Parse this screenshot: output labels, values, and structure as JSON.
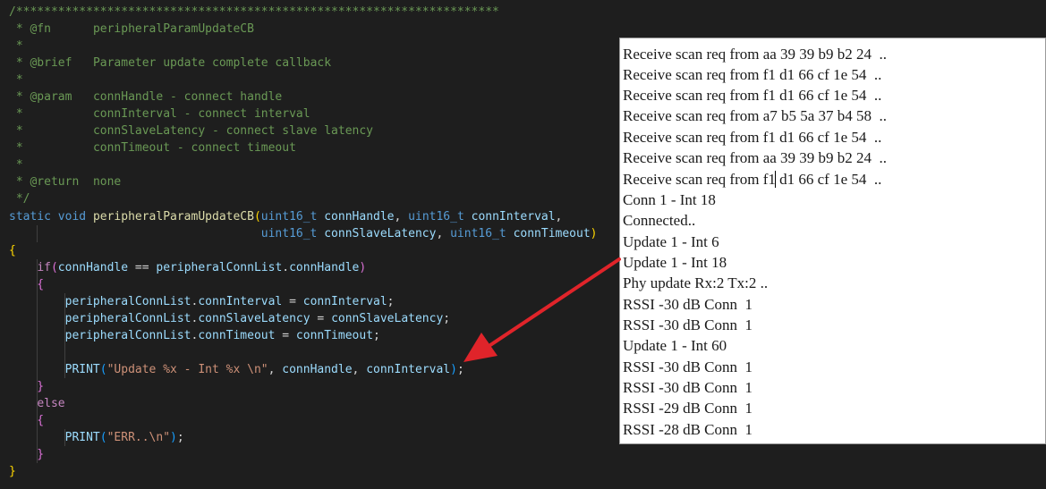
{
  "editor": {
    "lines": [
      "/*********************************************************************",
      " * @fn      peripheralParamUpdateCB",
      " *",
      " * @brief   Parameter update complete callback",
      " *",
      " * @param   connHandle - connect handle",
      " *          connInterval - connect interval",
      " *          connSlaveLatency - connect slave latency",
      " *          connTimeout - connect timeout",
      " *",
      " * @return  none",
      " */",
      "static void peripheralParamUpdateCB(uint16_t connHandle, uint16_t connInterval,",
      "                                    uint16_t connSlaveLatency, uint16_t connTimeout)",
      "{",
      "    if(connHandle == peripheralConnList.connHandle)",
      "    {",
      "        peripheralConnList.connInterval = connInterval;",
      "        peripheralConnList.connSlaveLatency = connSlaveLatency;",
      "        peripheralConnList.connTimeout = connTimeout;",
      "",
      "        PRINT(\"Update %x - Int %x \\n\", connHandle, connInterval);",
      "    }",
      "    else",
      "    {",
      "        PRINT(\"ERR..\\n\");",
      "    }",
      "}"
    ],
    "tokens": {
      "comment_border": "/*********************************************************************",
      "comment_star": " *",
      "comment_end": " */",
      "tag_fn": "@fn",
      "fn_name": "peripheralParamUpdateCB",
      "tag_brief": "@brief",
      "brief_text": "Parameter update complete callback",
      "tag_param": "@param",
      "param1": "connHandle - connect handle",
      "param2": "connInterval - connect interval",
      "param3": "connSlaveLatency - connect slave latency",
      "param4": "connTimeout - connect timeout",
      "tag_return": "@return",
      "return_text": "none",
      "kw_static": "static",
      "kw_void": "void",
      "type_u16": "uint16_t",
      "p_connHandle": "connHandle",
      "p_connInterval": "connInterval",
      "p_connSlaveLatency": "connSlaveLatency",
      "p_connTimeout": "connTimeout",
      "kw_if": "if",
      "kw_else": "else",
      "print": "PRINT",
      "list": "peripheralConnList",
      "f_connHandle": "connHandle",
      "f_connInterval": "connInterval",
      "f_connSlaveLatency": "connSlaveLatency",
      "f_connTimeout": "connTimeout",
      "str_update": "\"Update %x - Int %x \\n\"",
      "str_err": "\"ERR..\\n\""
    }
  },
  "terminal": {
    "lines": [
      "Receive scan req from aa 39 39 b9 b2 24  ..",
      "Receive scan req from f1 d1 66 cf 1e 54  ..",
      "Receive scan req from f1 d1 66 cf 1e 54  ..",
      "Receive scan req from a7 b5 5a 37 b4 58  ..",
      "Receive scan req from f1 d1 66 cf 1e 54  ..",
      "Receive scan req from aa 39 39 b9 b2 24  ..",
      "Receive scan req from f1 d1 66 cf 1e 54  ..",
      "Conn 1 - Int 18",
      "Connected..",
      "Update 1 - Int 6",
      "Update 1 - Int 18",
      "Phy update Rx:2 Tx:2 ..",
      "RSSI -30 dB Conn  1",
      "RSSI -30 dB Conn  1",
      "Update 1 - Int 60",
      "RSSI -30 dB Conn  1",
      "RSSI -30 dB Conn  1",
      "RSSI -29 dB Conn  1",
      "RSSI -28 dB Conn  1"
    ]
  },
  "colors": {
    "editor_bg": "#1e1e1e",
    "comment": "#6a9955",
    "keyword": "#569cd6",
    "function": "#dcdcaa",
    "variable": "#9cdcfe",
    "string": "#ce9178",
    "control": "#c586c0",
    "annotation_arrow": "#e0242a",
    "terminal_bg": "#ffffff"
  }
}
